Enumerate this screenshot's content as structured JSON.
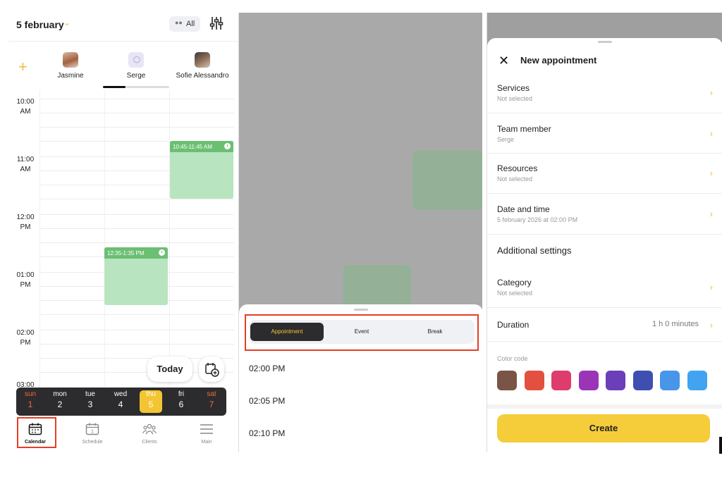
{
  "left_screen": {
    "date_title": "5 february",
    "all_label": "All",
    "members": [
      "Jasmine",
      "Serge",
      "Sofie Alessandro"
    ],
    "time_labels": [
      {
        "h": "10:00",
        "ap": "AM"
      },
      {
        "h": "11:00",
        "ap": "AM"
      },
      {
        "h": "12:00",
        "ap": "PM"
      },
      {
        "h": "01:00",
        "ap": "PM"
      },
      {
        "h": "02:00",
        "ap": "PM"
      },
      {
        "h": "03:00",
        "ap": ""
      }
    ],
    "appointments": [
      {
        "label": "10:45-11:45 AM"
      },
      {
        "label": "12:35-1:35 PM"
      }
    ],
    "today_button": "Today",
    "weekdays": [
      {
        "d": "sun",
        "n": "1"
      },
      {
        "d": "mon",
        "n": "2"
      },
      {
        "d": "tue",
        "n": "3"
      },
      {
        "d": "wed",
        "n": "4"
      },
      {
        "d": "thu",
        "n": "5"
      },
      {
        "d": "fri",
        "n": "6"
      },
      {
        "d": "sat",
        "n": "7"
      }
    ],
    "tabs": [
      "Calendar",
      "Schedule",
      "Clients",
      "Main"
    ],
    "schedule_icon_day": "1"
  },
  "middle_screen": {
    "segments": [
      "Appointment",
      "Event",
      "Break"
    ],
    "time_slots": [
      "02:00 PM",
      "02:05 PM",
      "02:10 PM"
    ]
  },
  "right_screen": {
    "title": "New appointment",
    "rows": [
      {
        "title": "Services",
        "sub": "Not selected"
      },
      {
        "title": "Team member",
        "sub": "Serge"
      },
      {
        "title": "Resources",
        "sub": "Not selected"
      },
      {
        "title": "Date and time",
        "sub": "5 february 2026 at 02:00 PM"
      }
    ],
    "additional_settings": "Additional settings",
    "category": {
      "title": "Category",
      "sub": "Not selected"
    },
    "duration": {
      "title": "Duration",
      "value": "1 h 0 minutes"
    },
    "color_code_label": "Color code",
    "color_swatches": [
      "#7a5446",
      "#e4503f",
      "#dd3c6c",
      "#9a35b7",
      "#6a3fb9",
      "#3f4fb1",
      "#4796ea",
      "#42a4f0"
    ],
    "create_button": "Create"
  },
  "colors": {
    "accent_yellow": "#f4c533",
    "appointment_green": "#6bbf73",
    "highlight_red": "#e53e26"
  }
}
